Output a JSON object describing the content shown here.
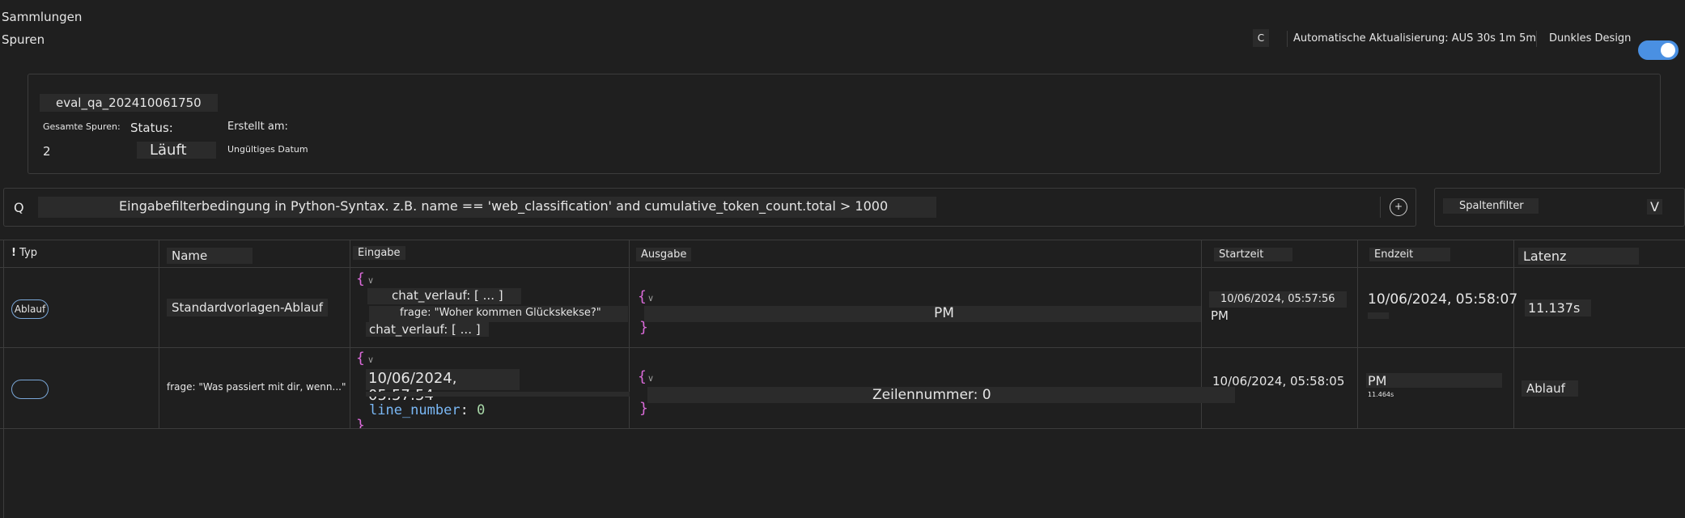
{
  "header": {
    "collections": "Sammlungen",
    "traces": "Spuren",
    "refresh_glyph": "C",
    "auto_refresh_label": "Automatische Aktualisierung:",
    "auto_refresh_off": "AUS",
    "auto_refresh_30s": "30s",
    "auto_refresh_1m": "1m",
    "auto_refresh_5m": "5m",
    "dark_design_label": "Dunkles Design",
    "dark_design_on": true
  },
  "run_card": {
    "name": "eval_qa_202410061750",
    "total_traces_label": "Gesamte Spuren:",
    "total_traces_value": "2",
    "status_label": "Status:",
    "status_value": "Läuft",
    "created_label": "Erstellt am:",
    "created_value": "Ungültiges Datum"
  },
  "filter": {
    "search_glyph": "Q",
    "placeholder": "Eingabefilterbedingung in Python-Syntax. z.B. name == 'web_classification' and cumulative_token_count.total > 1000",
    "column_filter": "Spaltenfilter",
    "column_filter_chevron": "V"
  },
  "table": {
    "headers": {
      "type": "Typ",
      "name": "Name",
      "input": "Eingabe",
      "output": "Ausgabe",
      "start": "Startzeit",
      "end": "Endzeit",
      "latency": "Latenz"
    },
    "rows": [
      {
        "type_badge": "Ablauf",
        "name": "Standardvorlagen-Ablauf",
        "input_lines": [
          "chat_verlauf: [ ... ]",
          "frage: \"Woher kommen Glückskekse?\"",
          "chat_verlauf: [ ... ]"
        ],
        "output_text": "PM",
        "start_date": "10/06/2024, 05:57:56",
        "start_pm": "PM",
        "end": "10/06/2024, 05:58:07",
        "latency": "11.137s"
      },
      {
        "type_badge": "",
        "name": "frage: \"Was passiert mit dir, wenn...\"",
        "input_date": "10/06/2024, 05:57:54",
        "input_code_key": "line_number",
        "input_code_value": "0",
        "output_text": "Zeilennummer: 0",
        "start": "10/06/2024, 05:58:05",
        "end_pm": "PM",
        "end_sub": "11.464s",
        "latency": "Ablauf"
      }
    ]
  },
  "colors": {
    "accent": "#4a90e2",
    "brace": "#d96ad8",
    "code_key": "#7ab8f5"
  }
}
